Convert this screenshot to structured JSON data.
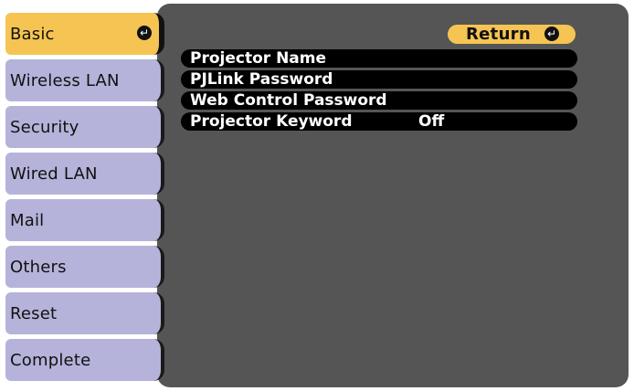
{
  "sidebar": {
    "items": [
      {
        "label": "Basic",
        "selected": true
      },
      {
        "label": "Wireless LAN",
        "selected": false
      },
      {
        "label": "Security",
        "selected": false
      },
      {
        "label": "Wired LAN",
        "selected": false
      },
      {
        "label": "Mail",
        "selected": false
      },
      {
        "label": "Others",
        "selected": false
      },
      {
        "label": "Reset",
        "selected": false
      },
      {
        "label": "Complete",
        "selected": false
      }
    ]
  },
  "main": {
    "return_label": "Return",
    "settings": [
      {
        "label": "Projector Name",
        "value": ""
      },
      {
        "label": "PJLink Password",
        "value": ""
      },
      {
        "label": "Web Control Password",
        "value": ""
      },
      {
        "label": "Projector Keyword",
        "value": "Off"
      }
    ]
  },
  "icons": {
    "enter": "enter-icon"
  },
  "colors": {
    "accent": "#f5c453",
    "tab": "#b5b3da",
    "panel": "#555555",
    "row": "#000000"
  }
}
